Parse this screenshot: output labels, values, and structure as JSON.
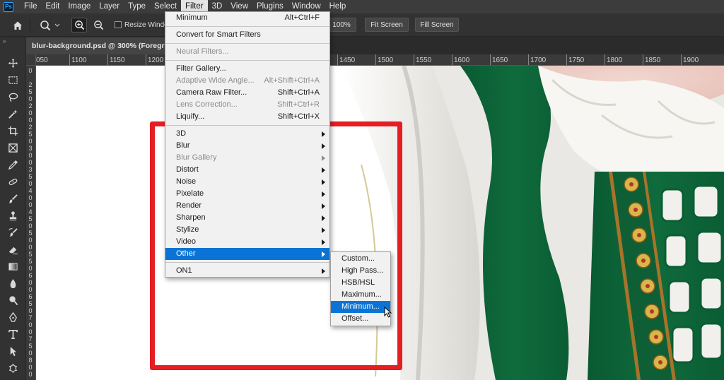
{
  "app": {
    "logo": "Ps"
  },
  "menubar": {
    "items": [
      {
        "label": "File"
      },
      {
        "label": "Edit"
      },
      {
        "label": "Image"
      },
      {
        "label": "Layer"
      },
      {
        "label": "Type"
      },
      {
        "label": "Select"
      },
      {
        "label": "Filter"
      },
      {
        "label": "3D"
      },
      {
        "label": "View"
      },
      {
        "label": "Plugins"
      },
      {
        "label": "Window"
      },
      {
        "label": "Help"
      }
    ],
    "active": "Filter"
  },
  "options_bar": {
    "resize_label": "Resize Window",
    "zoom_value": "100%",
    "fit_screen": "Fit Screen",
    "fill_screen": "Fill Screen"
  },
  "document": {
    "tab_title": "blur-background.psd @ 300% (Foreground, RGB/8)"
  },
  "rulers": {
    "h_ticks": [
      "050",
      "1100",
      "1150",
      "1200",
      "1450",
      "1500",
      "1550",
      "1600",
      "1650",
      "1700",
      "1750",
      "1800",
      "1850",
      "1900"
    ],
    "v_labels": [
      "0",
      "2 5 0",
      "2 0 0",
      "2 5 0",
      "3 0 0",
      "3 5 0",
      "4 0 0",
      "4 5 0",
      "5 0 0",
      "5 5 0",
      "6 0 0",
      "6 5 0",
      "7 0 0",
      "7 5 0",
      "8 0 0"
    ]
  },
  "filter_menu": {
    "top_items": [
      {
        "label": "Minimum",
        "shortcut": "Alt+Ctrl+F",
        "disabled": false
      }
    ],
    "group2": [
      {
        "label": "Convert for Smart Filters",
        "shortcut": "",
        "disabled": false
      }
    ],
    "group3": [
      {
        "label": "Neural Filters...",
        "shortcut": "",
        "disabled": true
      }
    ],
    "group4": [
      {
        "label": "Filter Gallery...",
        "shortcut": "",
        "disabled": false
      },
      {
        "label": "Adaptive Wide Angle...",
        "shortcut": "Alt+Shift+Ctrl+A",
        "disabled": true
      },
      {
        "label": "Camera Raw Filter...",
        "shortcut": "Shift+Ctrl+A",
        "disabled": false
      },
      {
        "label": "Lens Correction...",
        "shortcut": "Shift+Ctrl+R",
        "disabled": true
      },
      {
        "label": "Liquify...",
        "shortcut": "Shift+Ctrl+X",
        "disabled": false
      }
    ],
    "submenus": [
      {
        "label": "3D",
        "disabled": false
      },
      {
        "label": "Blur",
        "disabled": false
      },
      {
        "label": "Blur Gallery",
        "disabled": true
      },
      {
        "label": "Distort",
        "disabled": false
      },
      {
        "label": "Noise",
        "disabled": false
      },
      {
        "label": "Pixelate",
        "disabled": false
      },
      {
        "label": "Render",
        "disabled": false
      },
      {
        "label": "Sharpen",
        "disabled": false
      },
      {
        "label": "Stylize",
        "disabled": false
      },
      {
        "label": "Video",
        "disabled": false
      },
      {
        "label": "Other",
        "disabled": false,
        "highlight": true
      }
    ],
    "plugins": [
      {
        "label": "ON1",
        "disabled": false
      }
    ]
  },
  "other_submenu": {
    "items": [
      {
        "label": "Custom...",
        "disabled": false
      },
      {
        "label": "High Pass...",
        "disabled": false
      },
      {
        "label": "HSB/HSL",
        "disabled": false
      },
      {
        "label": "Maximum...",
        "disabled": false
      },
      {
        "label": "Minimum...",
        "disabled": false,
        "highlight": true
      },
      {
        "label": "Offset...",
        "disabled": false
      }
    ]
  },
  "colors": {
    "highlight": "#0a74d6",
    "annotation_red": "#e41e22",
    "dress_green": "#0f6b3c"
  },
  "tool_icons": [
    "move-icon",
    "marquee-icon",
    "lasso-icon",
    "magic-wand-icon",
    "crop-icon",
    "frame-icon",
    "eyedropper-icon",
    "healing-brush-icon",
    "brush-icon",
    "clone-stamp-icon",
    "history-brush-icon",
    "eraser-icon",
    "gradient-icon",
    "blur-tool-icon",
    "dodge-icon",
    "pen-icon",
    "type-icon",
    "path-select-icon",
    "custom-shape-icon"
  ]
}
